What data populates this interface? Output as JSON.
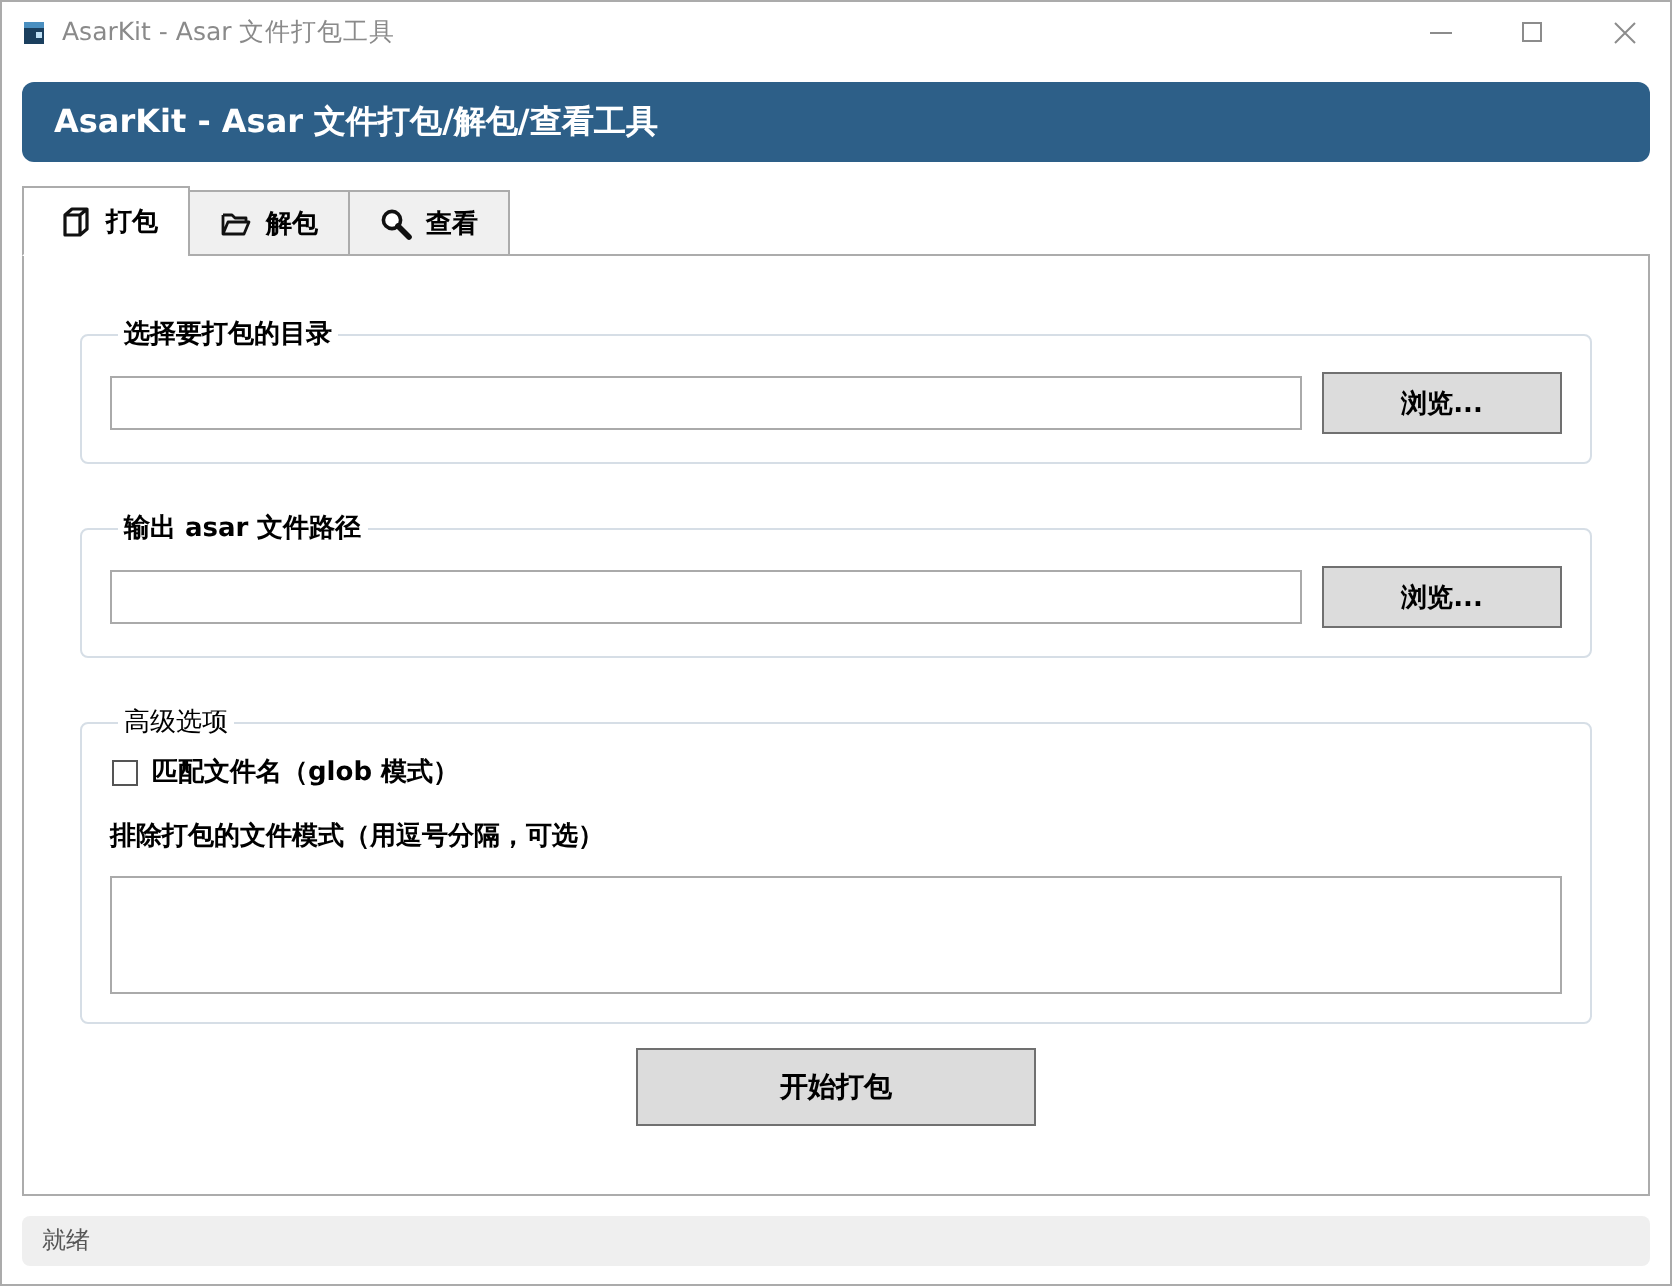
{
  "window": {
    "title": "AsarKit - Asar 文件打包工具"
  },
  "header": {
    "title": "AsarKit - Asar 文件打包/解包/查看工具"
  },
  "tabs": [
    {
      "label": "打包",
      "selected": true
    },
    {
      "label": "解包",
      "selected": false
    },
    {
      "label": "查看",
      "selected": false
    }
  ],
  "groups": [
    {
      "kind": "path",
      "legend": "选择要打包的目录",
      "button": "浏览..."
    },
    {
      "kind": "path",
      "legend": "输出 asar 文件路径",
      "button": "浏览..."
    },
    {
      "kind": "options",
      "legend": "高级选项",
      "checkbox": {
        "label": "匹配文件名（glob 模式）",
        "checked": false
      },
      "exclude_label": "排除打包的文件模式（用逗号分隔，可选）"
    }
  ],
  "primary_button": "开始打包",
  "status_bar": "就绪"
}
